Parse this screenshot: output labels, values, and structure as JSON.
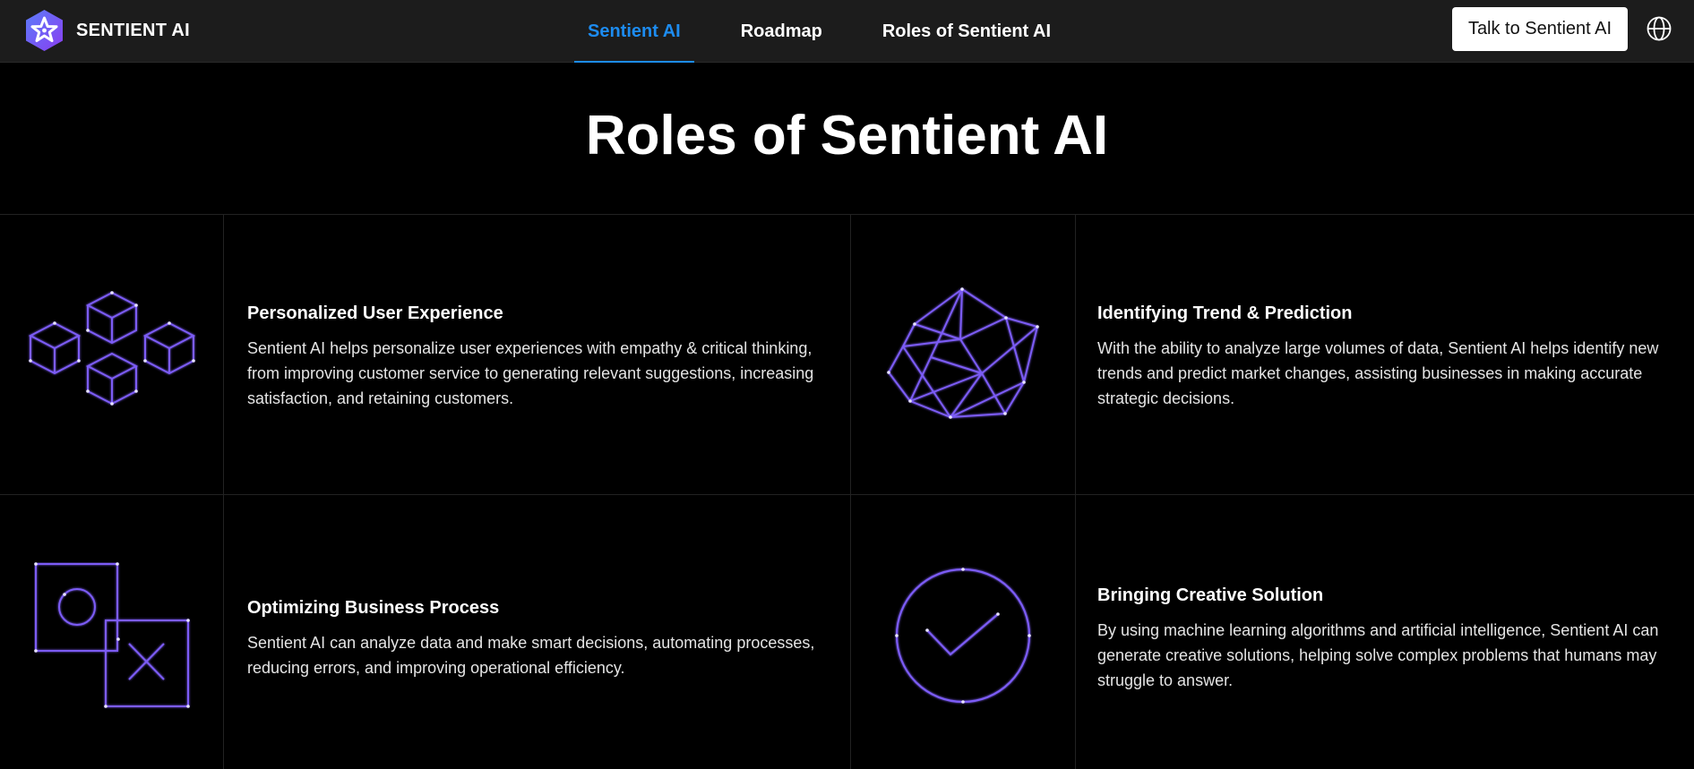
{
  "brand": {
    "name": "SENTIENT AI",
    "logo_icon": "star-hexagon-logo-icon"
  },
  "nav": {
    "tabs": [
      {
        "label": "Sentient AI",
        "active": true
      },
      {
        "label": "Roadmap",
        "active": false
      },
      {
        "label": "Roles of Sentient AI",
        "active": false
      }
    ],
    "cta_label": "Talk to Sentient AI",
    "language_icon": "globe-icon"
  },
  "page": {
    "title": "Roles of Sentient AI"
  },
  "cards": [
    {
      "icon": "cubes-icon",
      "title": "Personalized User Experience",
      "description": "Sentient AI helps personalize user experiences with empathy & critical thinking, from improving customer service to generating relevant suggestions, increasing satisfaction, and retaining customers."
    },
    {
      "icon": "network-polygon-icon",
      "title": "Identifying Trend & Prediction",
      "description": "With the ability to analyze large volumes of data, Sentient AI helps identify new trends and predict market changes, assisting businesses in making accurate strategic decisions."
    },
    {
      "icon": "circle-cross-squares-icon",
      "title": "Optimizing Business Process",
      "description": "Sentient AI can analyze data and make smart decisions, automating processes, reducing errors, and improving operational efficiency."
    },
    {
      "icon": "check-circle-icon",
      "title": "Bringing Creative Solution",
      "description": "By using machine learning algorithms and artificial intelligence, Sentient AI can generate creative solutions, helping solve complex problems that humans may struggle to answer."
    }
  ],
  "colors": {
    "accent": "#1d8cf0",
    "icon_purple": "#7b5cf5",
    "background": "#000000",
    "navbar": "#1c1c1c"
  }
}
